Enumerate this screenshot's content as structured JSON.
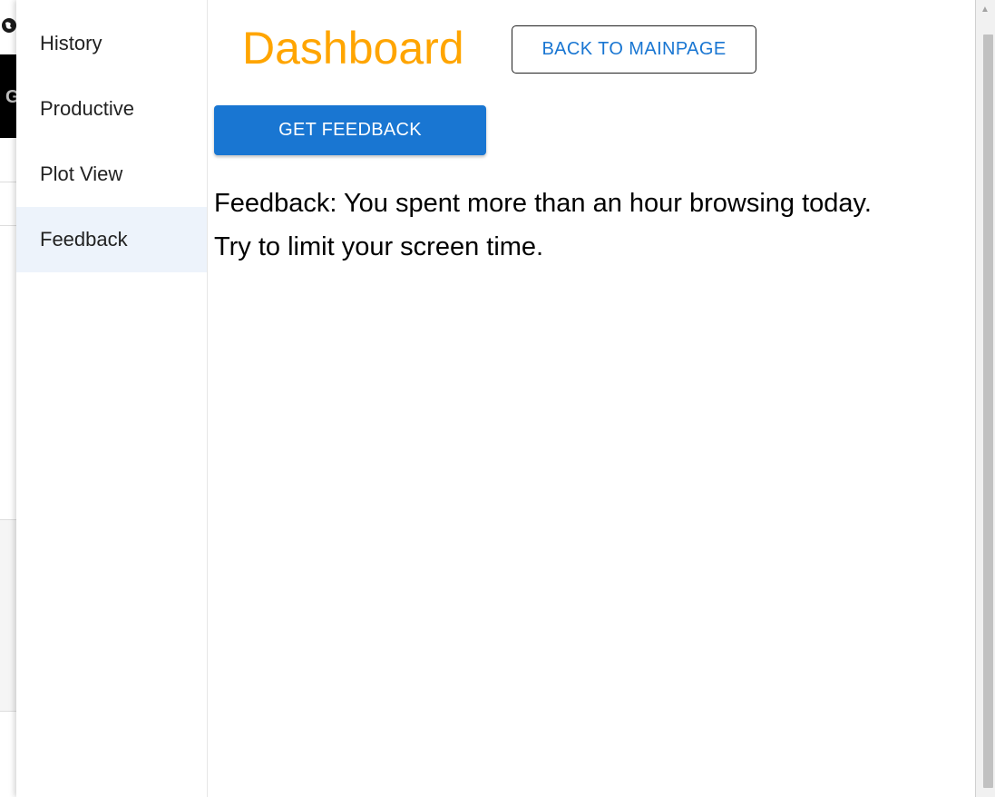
{
  "drawer": {
    "items": [
      {
        "label": "History",
        "selected": false
      },
      {
        "label": "Productive",
        "selected": false
      },
      {
        "label": "Plot View",
        "selected": false
      },
      {
        "label": "Feedback",
        "selected": true
      }
    ],
    "selected_bg": "#edf3fb"
  },
  "main": {
    "title": "Dashboard",
    "title_color": "#ffa500",
    "back_button_label": "BACK TO MAINPAGE",
    "feedback_button_label": "GET FEEDBACK",
    "feedback_line_1": "Feedback: You spent more than an hour browsing today.",
    "feedback_line_2": "Try to limit your screen time.",
    "accent_color": "#1976d2"
  },
  "background_page": {
    "banner_letter": "G",
    "globe_icon": "globe-icon"
  }
}
